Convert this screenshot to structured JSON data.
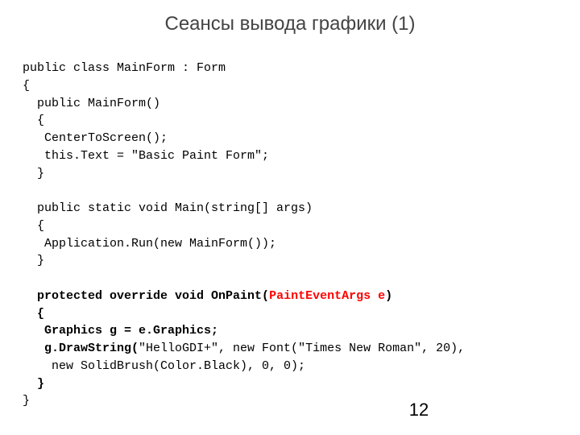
{
  "title": "Сеансы вывода графики (1)",
  "code": {
    "l1": "public class MainForm : Form",
    "l2": "{",
    "l3": "  public MainForm()",
    "l4": "  {",
    "l5": "   CenterToScreen();",
    "l6": "   this.Text = \"Basic Paint Form\";",
    "l7": "  }",
    "l8": "",
    "l9": "  public static void Main(string[] args)",
    "l10": "  {",
    "l11": "   Application.Run(new MainForm());",
    "l12": "  }",
    "l13": "",
    "l14a": "  protected override void OnPaint(",
    "l14b": "PaintEventArgs e",
    "l14c": ")",
    "l15": "  {",
    "l16": "   Graphics g = e.Graphics;",
    "l17a": "   g.DrawString(",
    "l17b": "\"HelloGDI+\", new Font(\"Times New Roman\", 20),",
    "l18": "    new SolidBrush(Color.Black), 0, 0);",
    "l19": "  }",
    "l20": "}"
  },
  "page_number": "12"
}
